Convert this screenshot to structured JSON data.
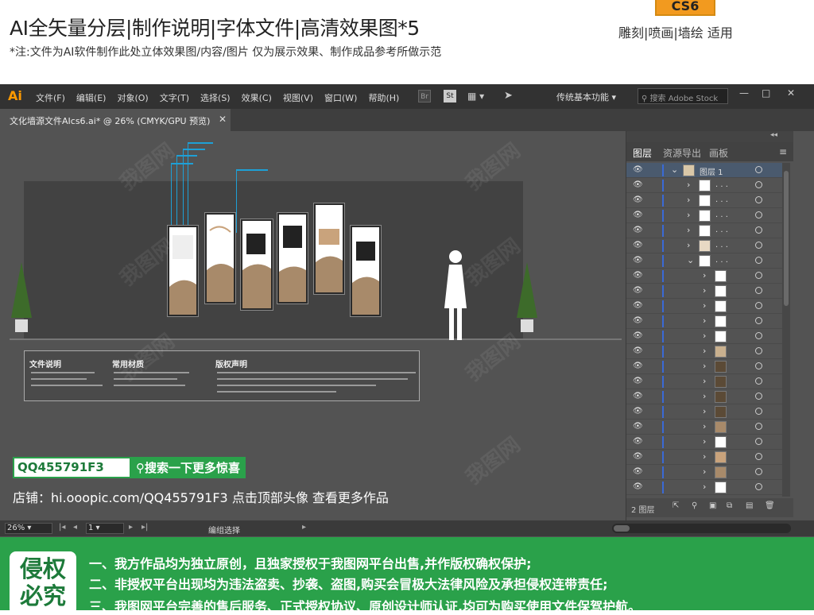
{
  "header": {
    "title": "AI全矢量分层|制作说明|字体文件|高清效果图*5",
    "note": "*注:文件为AI软件制作此处立体效果图/内容/图片 仅为展示效果、制作成品参考所做示范",
    "version_badge": "CS6",
    "keywords": "雕刻|喷画|墙绘 适用"
  },
  "app": {
    "logo": "Ai",
    "menus": [
      "文件(F)",
      "编辑(E)",
      "对象(O)",
      "文字(T)",
      "选择(S)",
      "效果(C)",
      "视图(V)",
      "窗口(W)",
      "帮助(H)"
    ],
    "bridge_label": "Br",
    "stock_label": "St",
    "workspace": "传统基本功能",
    "search_placeholder": "搜索 Adobe Stock",
    "window_buttons": [
      "—",
      "□",
      "✕"
    ]
  },
  "document_tab": {
    "title": "文化墙源文件AIcs6.ai* @ 26% (CMYK/GPU 预览)",
    "close": "✕"
  },
  "canvas": {
    "info_headings": [
      "文件说明",
      "常用材质",
      "版权声明"
    ],
    "qq_box": "QQ455791F3",
    "search_button": "搜索一下更多惊喜",
    "shop_line": "店铺：hi.ooopic.com/QQ455791F3  点击顶部头像 查看更多作品"
  },
  "layers_panel": {
    "collapse": "◂◂",
    "tabs": [
      "图层",
      "资源导出",
      "画板"
    ],
    "menu": "≡",
    "top_layer": "图层 1",
    "sublayer_name": ". . .",
    "footer_count": "2 图层"
  },
  "statusbar": {
    "zoom": "26%",
    "page": "1",
    "tool": "编组选择"
  },
  "footer": {
    "seal": "侵权必究",
    "lines": [
      "一、我方作品均为独立原创，且独家授权于我图网平台出售,并作版权确权保护;",
      "二、非授权平台出现均为违法盗卖、抄袭、盗图,购买会冒极大法律风险及承担侵权连带责任;",
      "三、我图网平台完善的售后服务、正式授权协议、原创设计师认证,均可为购买使用文件保驾护航。"
    ]
  },
  "watermark": "我图网",
  "colors": {
    "brand_green": "#2aa14a",
    "badge_orange": "#f29a1f",
    "ai_orange": "#ff9a00",
    "guide_blue": "#1ea0d6"
  }
}
